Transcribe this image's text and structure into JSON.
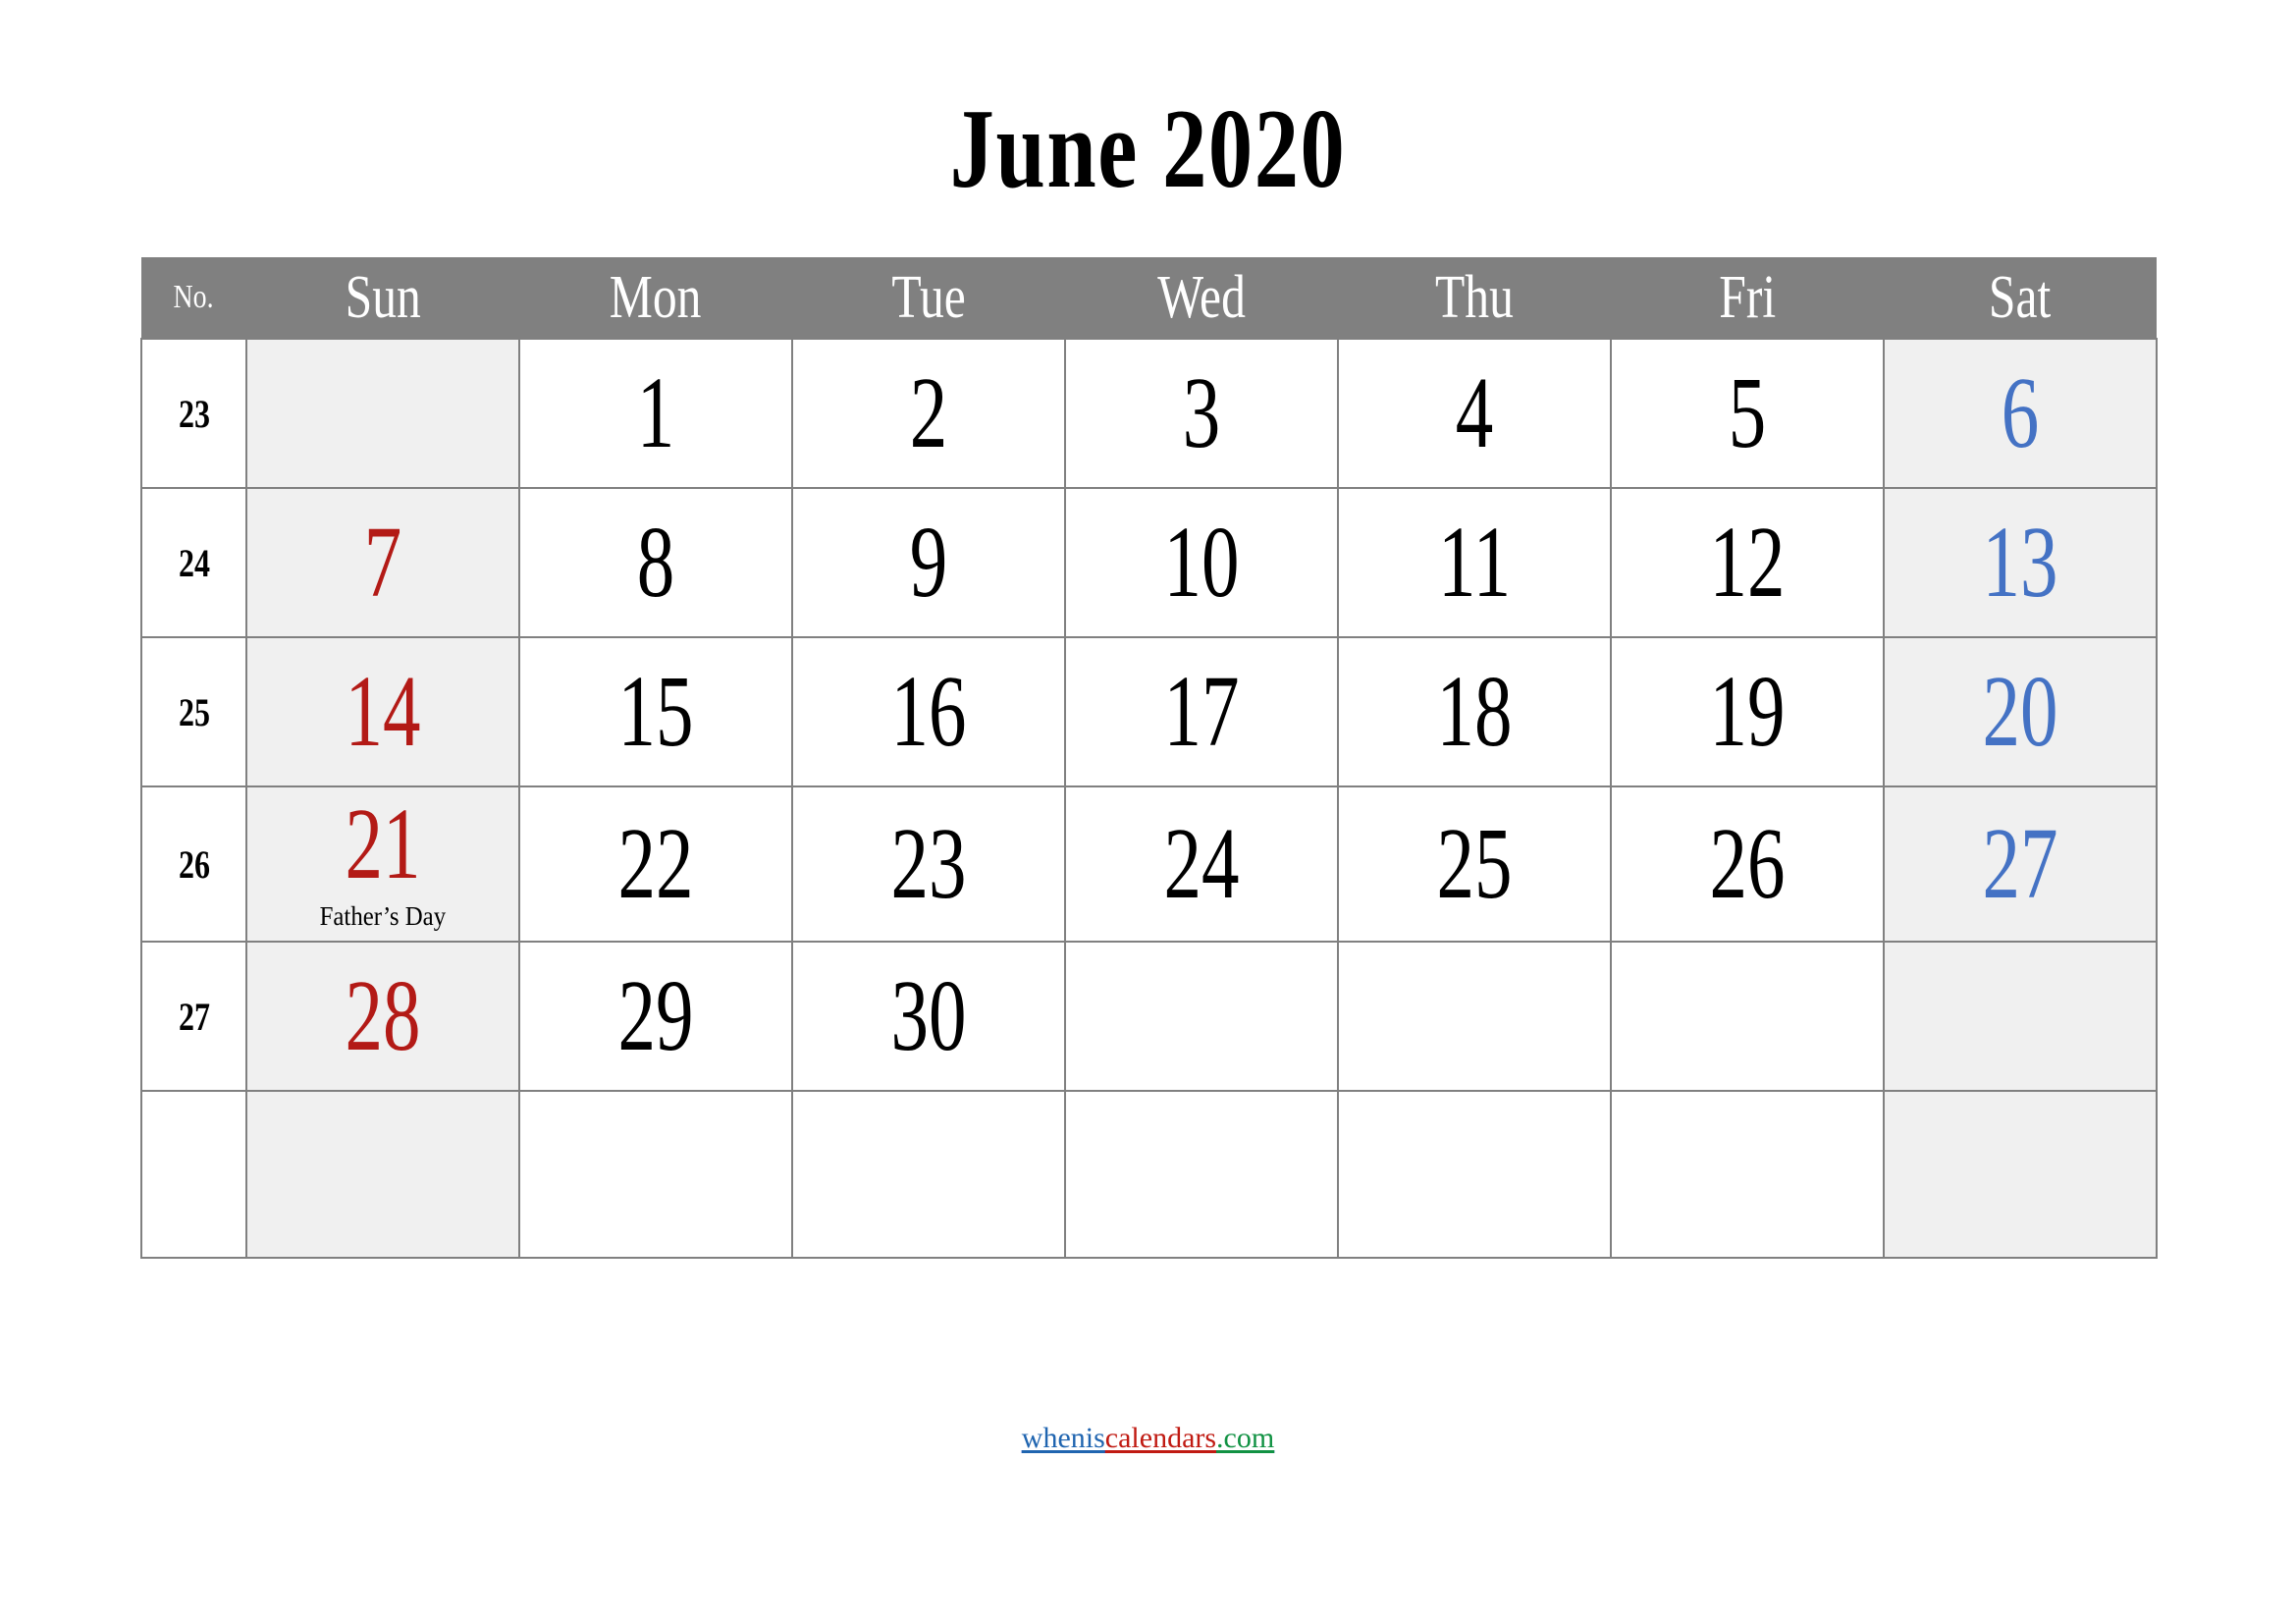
{
  "title": "June 2020",
  "header": {
    "week_number_label": "No.",
    "days": [
      "Sun",
      "Mon",
      "Tue",
      "Wed",
      "Thu",
      "Fri",
      "Sat"
    ]
  },
  "colors": {
    "header_background": "#808080",
    "header_text": "#ffffff",
    "weekend_cell_background": "#f0f0f0",
    "sunday_text": "#b31a16",
    "saturday_text": "#4472c4",
    "weekday_text": "#000000",
    "grid_border": "#808080",
    "footer_blue": "#2065b0",
    "footer_red": "#c01a12",
    "footer_green": "#119243"
  },
  "weeks": [
    {
      "number": "23",
      "days": [
        {
          "date": "",
          "note": ""
        },
        {
          "date": "1",
          "note": ""
        },
        {
          "date": "2",
          "note": ""
        },
        {
          "date": "3",
          "note": ""
        },
        {
          "date": "4",
          "note": ""
        },
        {
          "date": "5",
          "note": ""
        },
        {
          "date": "6",
          "note": ""
        }
      ]
    },
    {
      "number": "24",
      "days": [
        {
          "date": "7",
          "note": ""
        },
        {
          "date": "8",
          "note": ""
        },
        {
          "date": "9",
          "note": ""
        },
        {
          "date": "10",
          "note": ""
        },
        {
          "date": "11",
          "note": ""
        },
        {
          "date": "12",
          "note": ""
        },
        {
          "date": "13",
          "note": ""
        }
      ]
    },
    {
      "number": "25",
      "days": [
        {
          "date": "14",
          "note": ""
        },
        {
          "date": "15",
          "note": ""
        },
        {
          "date": "16",
          "note": ""
        },
        {
          "date": "17",
          "note": ""
        },
        {
          "date": "18",
          "note": ""
        },
        {
          "date": "19",
          "note": ""
        },
        {
          "date": "20",
          "note": ""
        }
      ]
    },
    {
      "number": "26",
      "days": [
        {
          "date": "21",
          "note": "Father’s Day"
        },
        {
          "date": "22",
          "note": ""
        },
        {
          "date": "23",
          "note": ""
        },
        {
          "date": "24",
          "note": ""
        },
        {
          "date": "25",
          "note": ""
        },
        {
          "date": "26",
          "note": ""
        }
      ]
    },
    {
      "number": "27",
      "days": [
        {
          "date": "28",
          "note": ""
        },
        {
          "date": "29",
          "note": ""
        },
        {
          "date": "30",
          "note": ""
        },
        {
          "date": "",
          "note": ""
        },
        {
          "date": "",
          "note": ""
        },
        {
          "date": "",
          "note": ""
        },
        {
          "date": "",
          "note": ""
        }
      ]
    },
    {
      "number": "",
      "days": [
        {
          "date": "",
          "note": ""
        },
        {
          "date": "",
          "note": ""
        },
        {
          "date": "",
          "note": ""
        },
        {
          "date": "",
          "note": ""
        },
        {
          "date": "",
          "note": ""
        },
        {
          "date": "",
          "note": ""
        },
        {
          "date": "",
          "note": ""
        }
      ]
    }
  ],
  "week26_extra": {
    "date": "27",
    "note": ""
  },
  "footer": {
    "segments": [
      "whenis",
      "calendars",
      ".com"
    ],
    "full": "wheniscalendars.com"
  }
}
